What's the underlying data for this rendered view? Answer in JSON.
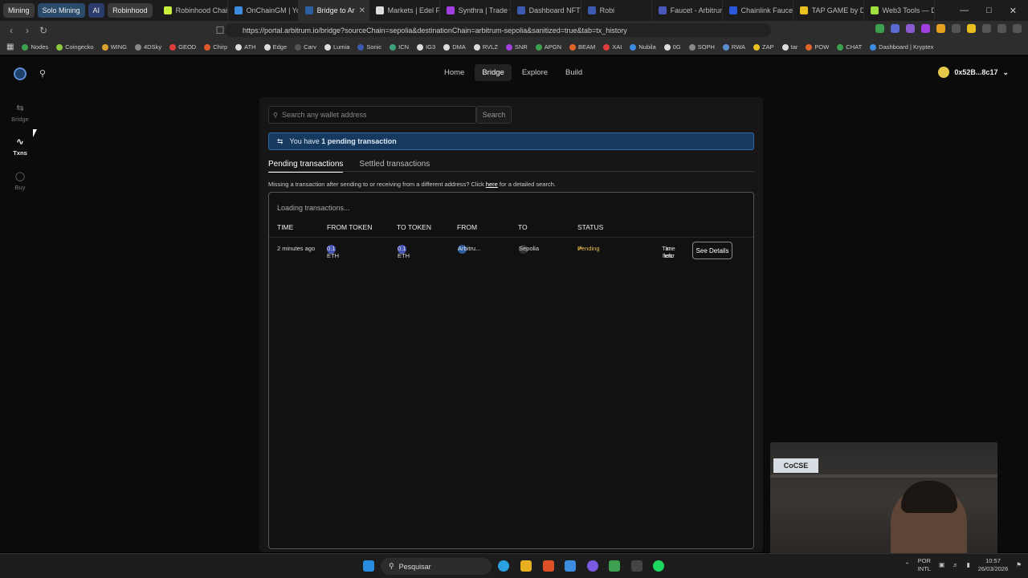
{
  "browser": {
    "tab_groups": [
      {
        "label": "Mining",
        "color": "#3a3a3a"
      },
      {
        "label": "Solo Mining",
        "color": "#2b4b6b"
      },
      {
        "label": "AI",
        "color": "#2b3b6b"
      },
      {
        "label": "Robinhood",
        "color": "#3a3a3a"
      }
    ],
    "tabs": [
      {
        "label": "Robinhood Chai",
        "color": "#c8f03c"
      },
      {
        "label": "OnChainGM | Yo",
        "color": "#3c8ce0"
      },
      {
        "label": "Bridge to Ar",
        "color": "#2d5ea0",
        "active": true
      },
      {
        "label": "Markets | Edel Fi",
        "color": "#dddddd"
      },
      {
        "label": "Synthra | Trade w",
        "color": "#a040e0"
      },
      {
        "label": "Dashboard NFT",
        "color": "#3c5ab0"
      },
      {
        "label": "Robi",
        "color": "#3c5ab0"
      },
      {
        "label": "Faucet - Arbitrum",
        "color": "#4a56b8"
      },
      {
        "label": "Chainlink Faucet",
        "color": "#2a5ada"
      },
      {
        "label": "TAP GAME by D",
        "color": "#e8c020"
      },
      {
        "label": "Web3 Tools — D",
        "color": "#a0e040"
      }
    ],
    "url": "https://portal.arbitrum.io/bridge?sourceChain=sepolia&destinationChain=arbitrum-sepolia&sanitized=true&tab=tx_history",
    "bookmarks": [
      {
        "label": "Nodes",
        "color": "#3ca050"
      },
      {
        "label": "Coingecko",
        "color": "#8cc83c"
      },
      {
        "label": "WING",
        "color": "#e0a030"
      },
      {
        "label": "4DSky",
        "color": "#888888"
      },
      {
        "label": "GEOD",
        "color": "#e03c3c"
      },
      {
        "label": "Chirp",
        "color": "#e05a28"
      },
      {
        "label": "ATH",
        "color": "#dddddd"
      },
      {
        "label": "Edge",
        "color": "#dddddd"
      },
      {
        "label": "Carv",
        "color": "#555555"
      },
      {
        "label": "Lumia",
        "color": "#dddddd"
      },
      {
        "label": "Sonic",
        "color": "#3c5ab0"
      },
      {
        "label": "ICN",
        "color": "#3ca078"
      },
      {
        "label": "IG3",
        "color": "#dddddd"
      },
      {
        "label": "DMA",
        "color": "#dddddd"
      },
      {
        "label": "RVLZ",
        "color": "#dddddd"
      },
      {
        "label": "SNR",
        "color": "#a040e0"
      },
      {
        "label": "APGN",
        "color": "#3ca050"
      },
      {
        "label": "BEAM",
        "color": "#e06428"
      },
      {
        "label": "XAI",
        "color": "#e03c3c"
      },
      {
        "label": "Nubila",
        "color": "#3c8ce0"
      },
      {
        "label": "0G",
        "color": "#dddddd"
      },
      {
        "label": "SOPH",
        "color": "#888888"
      },
      {
        "label": "RWA",
        "color": "#5a8cd0"
      },
      {
        "label": "ZAP",
        "color": "#e8c020"
      },
      {
        "label": "tar",
        "color": "#dddddd"
      },
      {
        "label": "POW",
        "color": "#e06428"
      },
      {
        "label": "CHAT",
        "color": "#3ca050"
      },
      {
        "label": "Dashboard | Kryptex",
        "color": "#3c8ce0"
      }
    ]
  },
  "sidebar": {
    "items": [
      {
        "label": "Bridge",
        "icon": "swap-icon"
      },
      {
        "label": "Txns",
        "icon": "activity-icon",
        "active": true
      },
      {
        "label": "Buy",
        "icon": "coin-icon"
      }
    ]
  },
  "topnav": {
    "items": [
      "Home",
      "Bridge",
      "Explore",
      "Build"
    ],
    "active": "Bridge"
  },
  "wallet": {
    "address": "0x52B...8c17"
  },
  "search": {
    "placeholder": "Search any wallet address",
    "button": "Search"
  },
  "banner": {
    "prefix": "You have ",
    "emphasis": "1 pending transaction"
  },
  "tabs": {
    "pending": "Pending transactions",
    "settled": "Settled transactions"
  },
  "missing_note": {
    "text": "Missing a transaction after sending to or receiving from a different address? Click ",
    "link": "here",
    "suffix": " for a detailed search."
  },
  "table": {
    "loading": "Loading transactions...",
    "headers": [
      "TIME",
      "FROM TOKEN",
      "TO TOKEN",
      "FROM",
      "TO",
      "STATUS"
    ],
    "rows": [
      {
        "time": "2 minutes ago",
        "from_token": "0.1 ETH",
        "to_token": "0.1 ETH",
        "from": "Arbitru...",
        "to": "Sepolia",
        "status": "Pending",
        "time_left_label": "Time left:",
        "time_left_value": "an hour",
        "action": "See Details"
      }
    ]
  },
  "webcam": {
    "sign": "CoCSE"
  },
  "taskbar": {
    "search": "Pesquisar",
    "lang_top": "POR",
    "lang_bottom": "INTL",
    "time": "10:57",
    "date": "26/03/2026"
  }
}
